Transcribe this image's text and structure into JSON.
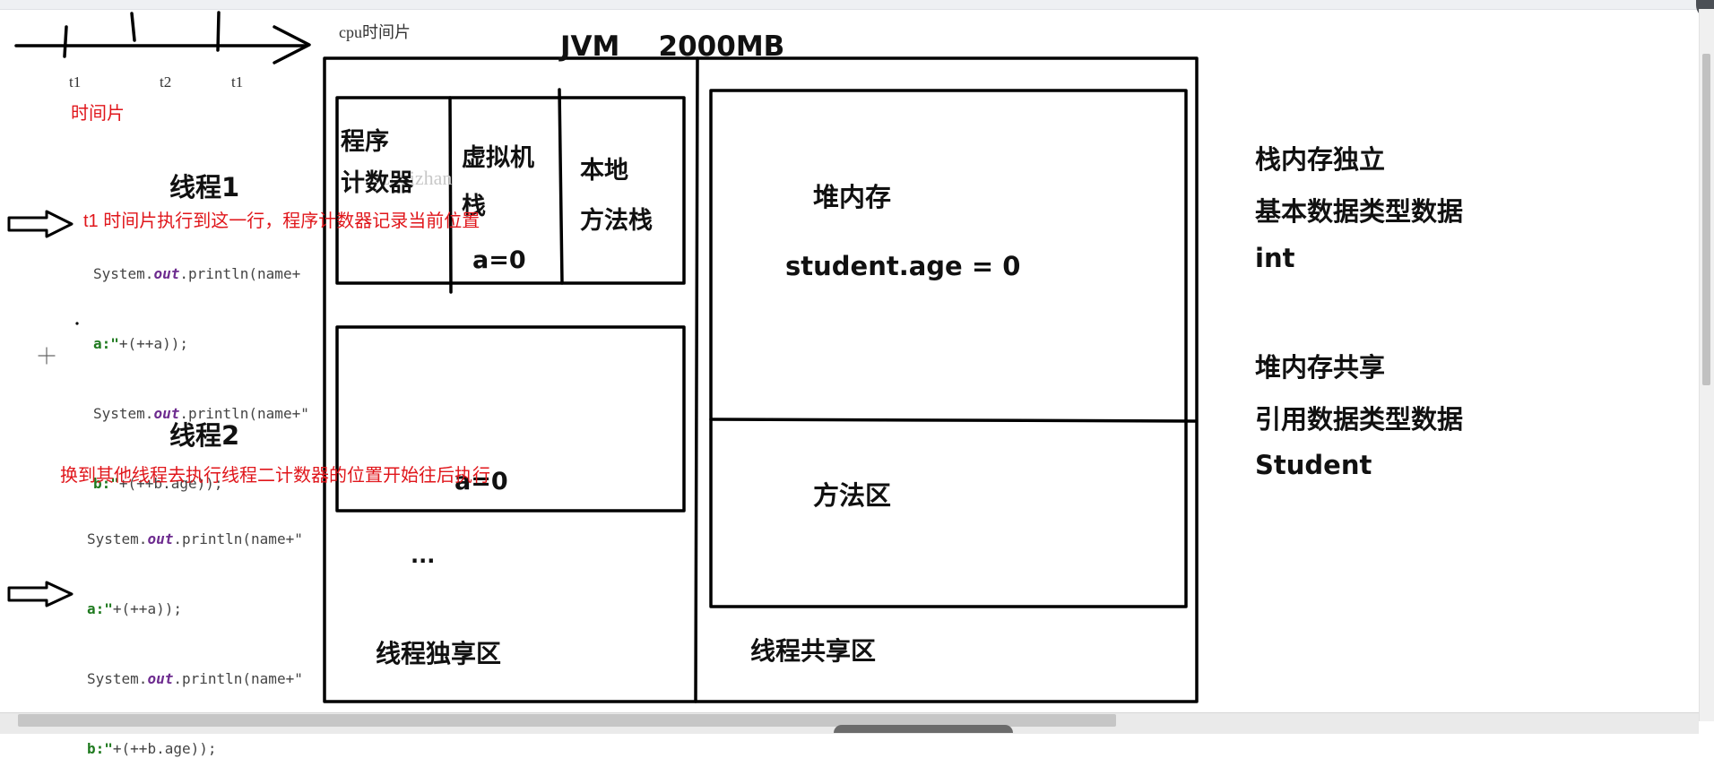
{
  "timeline": {
    "caption": "cpu时间片",
    "ticks": [
      "t1",
      "t2",
      "t1"
    ],
    "label": "时间片"
  },
  "jvm": {
    "title": "JVM    2000MB",
    "stack": {
      "pc_register": [
        "程序",
        "计数器"
      ],
      "vm_stack": [
        "虚拟机",
        "栈"
      ],
      "vm_stack_value": "a=0",
      "native_stack": [
        "本地",
        "方法栈"
      ],
      "second_value": "a=0",
      "ellipsis": "...",
      "area_label": "线程独享区"
    },
    "shared": {
      "heap_label": "堆内存",
      "heap_value": "student.age = 0",
      "method_area": "方法区",
      "area_label": "线程共享区"
    },
    "watermark": "zhuizhan"
  },
  "threads": {
    "thread1": {
      "label": "线程1",
      "note": "t1 时间片执行到这一行，程序计数器记录当前位置",
      "code_line1_a": "System.",
      "code_line1_kw": "out",
      "code_line1_b": ".println(name+",
      "code_line2_str": "a:\"",
      "code_line2_rest": "+(++a));",
      "code_line3_a": "System.",
      "code_line3_kw": "out",
      "code_line3_b": ".println(name+\"",
      "code_line4_str": "b:\"",
      "code_line4_rest": "+(++b.age));"
    },
    "thread2": {
      "label": "线程2",
      "note": "换到其他线程去执行线程二计数器的位置开始往后执行",
      "code_line1_a": "System.",
      "code_line1_kw": "out",
      "code_line1_b": ".println(name+\"",
      "code_line2_str": "a:\"",
      "code_line2_rest": "+(++a));",
      "code_line3_a": "System.",
      "code_line3_kw": "out",
      "code_line3_b": ".println(name+\"",
      "code_line4_str": "b:\"",
      "code_line4_rest": "+(++b.age));"
    }
  },
  "notes": {
    "stack_title": "栈内存独立",
    "stack_line2": "基本数据类型数据",
    "stack_line3": "int",
    "heap_title": "堆内存共享",
    "heap_line2": "引用数据类型数据",
    "heap_line3": "Student"
  }
}
